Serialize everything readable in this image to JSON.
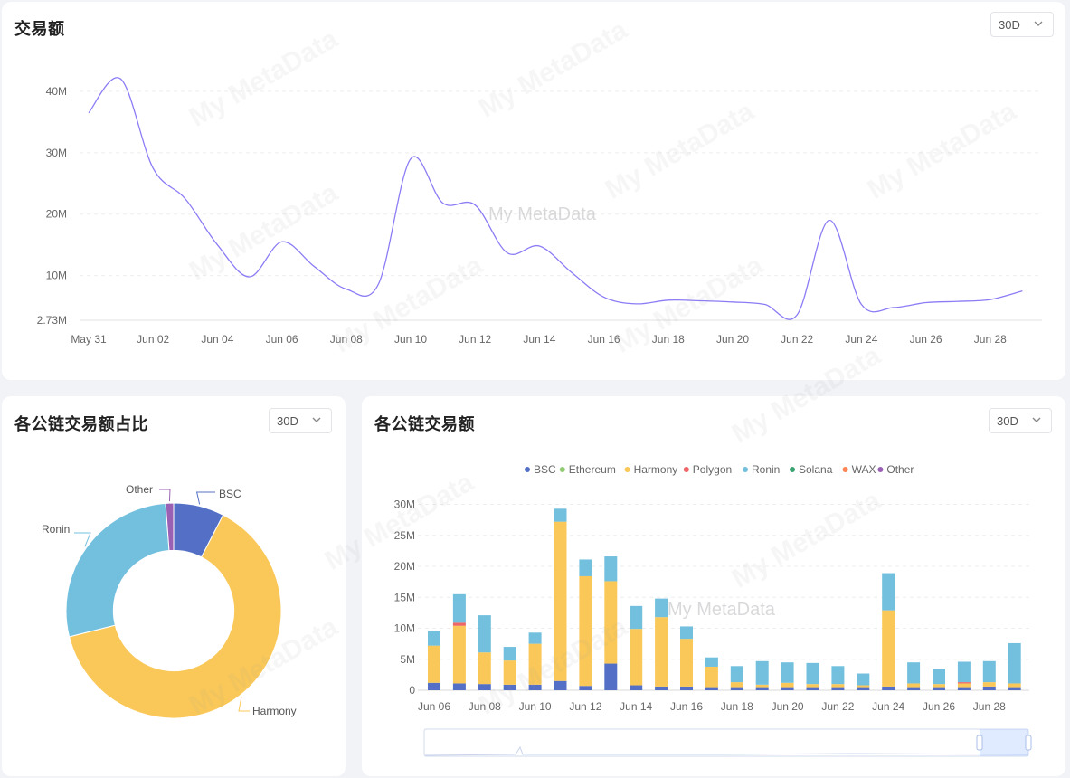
{
  "panel_top": {
    "title": "交易额",
    "range": "30D"
  },
  "panel_pie": {
    "title": "各公链交易额占比",
    "range": "30D"
  },
  "panel_stack": {
    "title": "各公链交易额",
    "range": "30D"
  },
  "watermark": "My MetaData",
  "colors": {
    "BSC": "#5470c6",
    "Ethereum": "#91cc75",
    "Harmony": "#fac858",
    "Polygon": "#ee6666",
    "Ronin": "#73c0de",
    "Solana": "#3ba272",
    "WAX": "#fc8452",
    "Other": "#9a60b4",
    "line": "#8b7cf5"
  },
  "chart_data": [
    {
      "type": "line",
      "x": [
        "May 31",
        "Jun 01",
        "Jun 02",
        "Jun 03",
        "Jun 04",
        "Jun 05",
        "Jun 06",
        "Jun 07",
        "Jun 08",
        "Jun 09",
        "Jun 10",
        "Jun 11",
        "Jun 12",
        "Jun 13",
        "Jun 14",
        "Jun 15",
        "Jun 16",
        "Jun 17",
        "Jun 18",
        "Jun 19",
        "Jun 20",
        "Jun 21",
        "Jun 22",
        "Jun 23",
        "Jun 24",
        "Jun 25",
        "Jun 26",
        "Jun 27",
        "Jun 28",
        "Jun 29"
      ],
      "values": [
        36.5,
        42,
        27.5,
        22.5,
        15,
        9.8,
        15.5,
        11.5,
        7.8,
        8.6,
        29,
        21.8,
        21.5,
        13.7,
        14.8,
        10.5,
        6.5,
        5.4,
        6,
        5.9,
        5.7,
        5.3,
        3.6,
        19,
        5.3,
        4.8,
        5.6,
        5.8,
        6.1,
        7.5
      ],
      "xticks": [
        "May 31",
        "Jun 02",
        "Jun 04",
        "Jun 06",
        "Jun 08",
        "Jun 10",
        "Jun 12",
        "Jun 14",
        "Jun 16",
        "Jun 18",
        "Jun 20",
        "Jun 22",
        "Jun 24",
        "Jun 26",
        "Jun 28"
      ],
      "yticks": [
        "2.73M",
        "10M",
        "20M",
        "30M",
        "40M"
      ],
      "ylim": [
        2.73,
        45
      ],
      "grid": true
    },
    {
      "type": "pie",
      "slices": [
        {
          "name": "BSC",
          "value": 7.6
        },
        {
          "name": "Harmony",
          "value": 63.5
        },
        {
          "name": "Ronin",
          "value": 27.7
        },
        {
          "name": "Other",
          "value": 1.2
        }
      ],
      "inner_radius_ratio": 0.56
    },
    {
      "type": "bar",
      "stacked": true,
      "legend": [
        "BSC",
        "Ethereum",
        "Harmony",
        "Polygon",
        "Ronin",
        "Solana",
        "WAX",
        "Other"
      ],
      "legend_position": "top-center",
      "categories": [
        "Jun 06",
        "Jun 07",
        "Jun 08",
        "Jun 09",
        "Jun 10",
        "Jun 11",
        "Jun 12",
        "Jun 13",
        "Jun 14",
        "Jun 15",
        "Jun 16",
        "Jun 17",
        "Jun 18",
        "Jun 19",
        "Jun 20",
        "Jun 21",
        "Jun 22",
        "Jun 23",
        "Jun 24",
        "Jun 25",
        "Jun 26",
        "Jun 27",
        "Jun 28",
        "Jun 29"
      ],
      "xticks": [
        "Jun 06",
        "Jun 08",
        "Jun 10",
        "Jun 12",
        "Jun 14",
        "Jun 16",
        "Jun 18",
        "Jun 20",
        "Jun 22",
        "Jun 24",
        "Jun 26",
        "Jun 28"
      ],
      "yticks": [
        "0",
        "5M",
        "10M",
        "15M",
        "20M",
        "25M",
        "30M"
      ],
      "ylim": [
        0,
        30
      ],
      "series": [
        {
          "name": "BSC",
          "values": [
            1.2,
            1.1,
            1.0,
            0.9,
            0.9,
            1.5,
            0.7,
            4.3,
            0.8,
            0.6,
            0.6,
            0.5,
            0.5,
            0.5,
            0.5,
            0.5,
            0.5,
            0.5,
            0.6,
            0.5,
            0.5,
            0.5,
            0.6,
            0.5
          ]
        },
        {
          "name": "Ethereum",
          "values": [
            0,
            0,
            0,
            0,
            0,
            0,
            0,
            0,
            0,
            0,
            0,
            0,
            0,
            0,
            0,
            0,
            0,
            0,
            0,
            0,
            0,
            0,
            0,
            0
          ]
        },
        {
          "name": "Harmony",
          "values": [
            6.0,
            9.3,
            5.1,
            3.9,
            6.6,
            25.7,
            17.7,
            13.3,
            9.1,
            11.2,
            7.7,
            3.3,
            0.8,
            0.4,
            0.7,
            0.5,
            0.5,
            0.3,
            12.3,
            0.6,
            0.5,
            0.6,
            0.7,
            0.6
          ]
        },
        {
          "name": "Polygon",
          "values": [
            0,
            0.5,
            0,
            0,
            0,
            0,
            0,
            0,
            0,
            0,
            0,
            0,
            0,
            0,
            0,
            0,
            0,
            0,
            0,
            0,
            0,
            0.2,
            0,
            0
          ]
        },
        {
          "name": "Ronin",
          "values": [
            2.4,
            4.6,
            6.0,
            2.2,
            1.8,
            2.1,
            2.7,
            4.0,
            3.7,
            3.0,
            2.0,
            1.5,
            2.6,
            3.8,
            3.3,
            3.4,
            2.9,
            1.9,
            6.0,
            3.4,
            2.5,
            3.3,
            3.4,
            6.5
          ]
        },
        {
          "name": "Solana",
          "values": [
            0,
            0,
            0,
            0,
            0,
            0,
            0,
            0,
            0,
            0,
            0,
            0,
            0,
            0,
            0,
            0,
            0,
            0,
            0,
            0,
            0,
            0,
            0,
            0
          ]
        },
        {
          "name": "WAX",
          "values": [
            0,
            0,
            0,
            0,
            0,
            0,
            0,
            0,
            0,
            0,
            0,
            0,
            0,
            0,
            0,
            0,
            0,
            0,
            0,
            0,
            0,
            0,
            0,
            0
          ]
        },
        {
          "name": "Other",
          "values": [
            0,
            0,
            0,
            0,
            0,
            0,
            0,
            0,
            0,
            0,
            0,
            0,
            0,
            0,
            0,
            0,
            0,
            0,
            0,
            0,
            0,
            0,
            0,
            0
          ]
        }
      ],
      "has_zoom_slider": true
    }
  ]
}
